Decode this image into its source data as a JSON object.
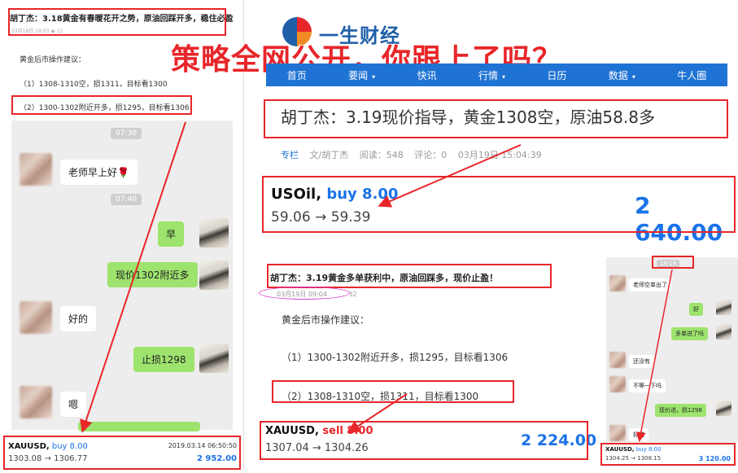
{
  "left": {
    "title": "胡丁杰：3.18黄金有春暖花开之势，原油回踩开多，稳住必盈！",
    "meta": "03月18日 19:03",
    "views": "12",
    "advice_heading": "黄金后市操作建议：",
    "advice_1": "（1）1308-1310空，损1311，目标看1300",
    "advice_2": "（2）1300-1302附近开多，损1295，目标看1306",
    "chat": {
      "time1": "07:30",
      "msg1": "老师早上好🌹",
      "time2": "07:40",
      "msg2": "早",
      "msg3": "现价1302附近多",
      "msg4": "好的",
      "msg5": "止损1298",
      "msg6": "嗯"
    },
    "trade": {
      "symbol": "XAUUSD,",
      "side": "buy 8.00",
      "time": "2019.03.14 06:50:50",
      "prices": "1303.08 → 1306.77",
      "profit": "2 952.00"
    }
  },
  "header": {
    "logo_text": "一生财经",
    "headline": "策略全网公开，你跟上了吗？"
  },
  "nav": {
    "items": [
      {
        "label": "首页",
        "caret": ""
      },
      {
        "label": "要闻",
        "caret": "▾"
      },
      {
        "label": "快讯",
        "caret": ""
      },
      {
        "label": "行情",
        "caret": "▾"
      },
      {
        "label": "日历",
        "caret": ""
      },
      {
        "label": "数据",
        "caret": "▾"
      },
      {
        "label": "牛人圈",
        "caret": ""
      }
    ]
  },
  "article": {
    "title": "胡丁杰：3.19现价指导，黄金1308空，原油58.8多",
    "tag": "专栏",
    "author": "文/胡丁杰",
    "reads": "阅读：548",
    "comments": "评论：0",
    "date": "03月19日 15:04:39"
  },
  "usoil": {
    "symbol": "USOil,",
    "side": "buy 8.00",
    "prices": "59.06 → 59.39",
    "profit": "2 640.00"
  },
  "sub_article": {
    "title": "胡丁杰：3.19黄金多单获利中，原油回踩多，现价止盈！",
    "meta": "03月19日 09:04",
    "views": "32",
    "advice_heading": "黄金后市操作建议：",
    "advice_1": "（1）1300-1302附近开多，损1295，目标看1306",
    "advice_2": "（2）1308-1310空，损1311，目标看1300"
  },
  "xau_sell": {
    "symbol": "XAUUSD,",
    "side": "sell 8.00",
    "prices": "1307.04 → 1304.26",
    "profit": "2 224.00"
  },
  "right_chat": {
    "time": "19:18",
    "msg1": "老师空单出了",
    "msg2": "好",
    "msg3": "多单进了吗",
    "msg4": "还没有",
    "msg5": "不等一下吗",
    "msg6": "现价进，损1298",
    "msg7": "好的",
    "trade_symbol": "XAUUSD,",
    "trade_side": "buy 8.00",
    "trade_prices": "1304.25 → 1308.15",
    "trade_profit": "3 120.00"
  },
  "colors": {
    "accent_red": "#e8262a",
    "nav_blue": "#1f73d4",
    "profit_blue": "#1a73e8",
    "bubble_green": "#9de36d"
  }
}
